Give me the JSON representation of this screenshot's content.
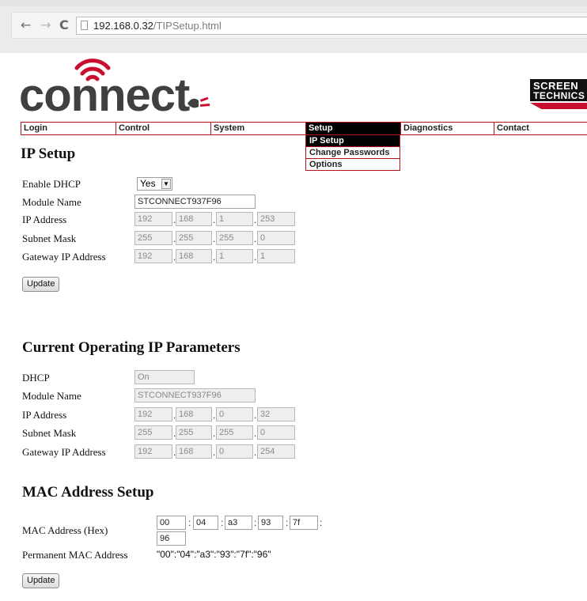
{
  "browser": {
    "url_host": "192.168.0.32",
    "url_path": "/TIPSetup.html",
    "back_glyph": "←",
    "forward_glyph": "→",
    "reload_glyph": "C"
  },
  "logo": {
    "word": "connect",
    "brand_line1": "SCREEN",
    "brand_line2": "TECHNICS",
    "accent_color": "#c8102e"
  },
  "nav": {
    "items": [
      {
        "label": "Login"
      },
      {
        "label": "Control"
      },
      {
        "label": "System"
      },
      {
        "label": "Setup"
      },
      {
        "label": "Diagnostics"
      },
      {
        "label": "Contact"
      }
    ],
    "submenu": [
      "IP Setup",
      "Change Passwords",
      "Options"
    ]
  },
  "ip_setup": {
    "title": "IP Setup",
    "dhcp_label": "Enable DHCP",
    "dhcp_value": "Yes",
    "module_label": "Module Name",
    "module_value": "STCONNECT937F96",
    "ip_label": "IP Address",
    "ip": [
      "192",
      "168",
      "1",
      "253"
    ],
    "mask_label": "Subnet Mask",
    "mask": [
      "255",
      "255",
      "255",
      "0"
    ],
    "gw_label": "Gateway IP Address",
    "gw": [
      "192",
      "168",
      "1",
      "1"
    ],
    "update_label": "Update"
  },
  "current": {
    "title": "Current Operating IP Parameters",
    "dhcp_label": "DHCP",
    "dhcp_value": "On",
    "module_label": "Module Name",
    "module_value": "STCONNECT937F96",
    "ip_label": "IP Address",
    "ip": [
      "192",
      "168",
      "0",
      "32"
    ],
    "mask_label": "Subnet Mask",
    "mask": [
      "255",
      "255",
      "255",
      "0"
    ],
    "gw_label": "Gateway IP Address",
    "gw": [
      "192",
      "168",
      "0",
      "254"
    ]
  },
  "mac": {
    "title": "MAC Address Setup",
    "hex_label": "MAC Address (Hex)",
    "octets": [
      "00",
      "04",
      "a3",
      "93",
      "7f",
      "96"
    ],
    "perm_label": "Permanent MAC Address",
    "perm_value": "\"00\":\"04\":\"a3\":\"93\":\"7f\":\"96\"",
    "update_label": "Update"
  }
}
